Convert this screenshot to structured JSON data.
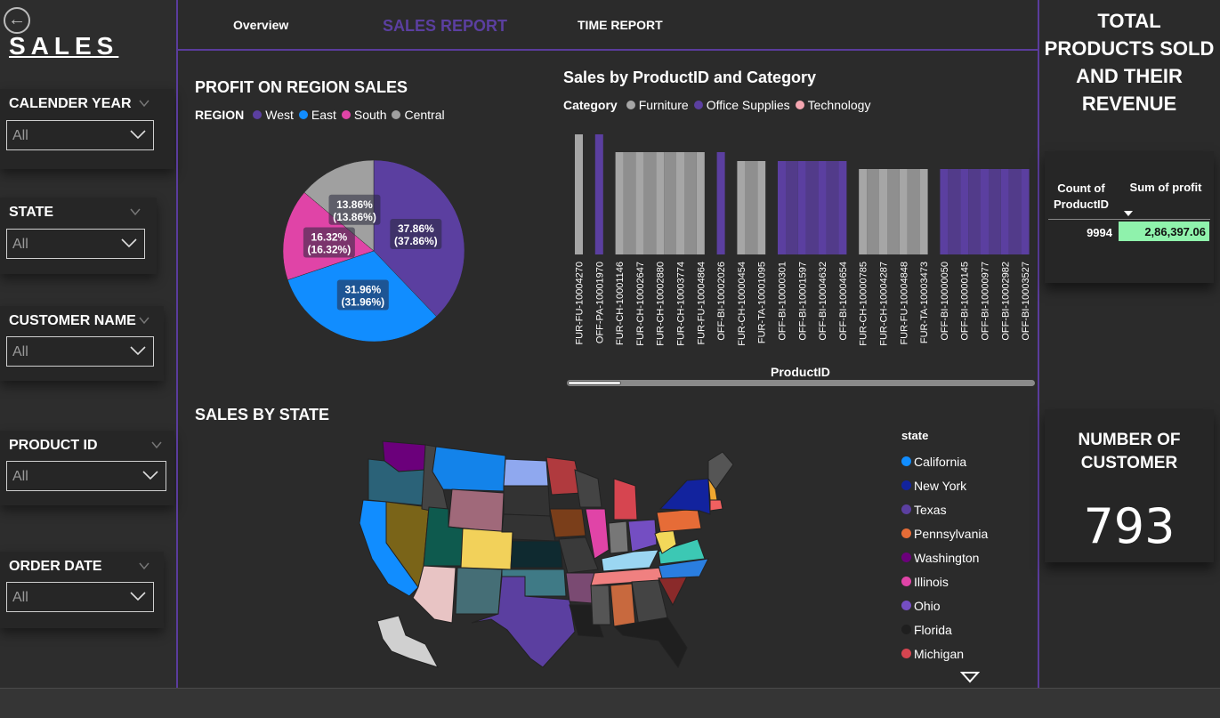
{
  "brand": {
    "title": "SALES"
  },
  "slicers": [
    {
      "title": "CALENDER YEAR",
      "value": "All"
    },
    {
      "title": "STATE",
      "value": "All"
    },
    {
      "title": "CUSTOMER NAME",
      "value": "All"
    },
    {
      "title": "PRODUCT ID",
      "value": "All"
    },
    {
      "title": "ORDER DATE",
      "value": "All"
    }
  ],
  "nav": {
    "overview": "Overview",
    "sales_report": "SALES REPORT",
    "time_report": "TIME REPORT"
  },
  "pie": {
    "title": "PROFIT ON REGION SALES",
    "legend_title": "REGION",
    "regions": [
      {
        "name": "West",
        "value": 37.86,
        "label": "37.86%",
        "sub": "(37.86%)",
        "color": "#5b3fa0"
      },
      {
        "name": "East",
        "value": 31.96,
        "label": "31.96%",
        "sub": "(31.96%)",
        "color": "#118dff"
      },
      {
        "name": "South",
        "value": 16.32,
        "label": "16.32%",
        "sub": "(16.32%)",
        "color": "#e044a7"
      },
      {
        "name": "Central",
        "value": 13.86,
        "label": "13.86%",
        "sub": "(13.86%)",
        "color": "#a0a0a0"
      }
    ]
  },
  "bars": {
    "title": "Sales by ProductID and Category",
    "legend_title": "Category",
    "xlabel": "ProductID",
    "categories": [
      {
        "name": "Furniture",
        "color": "#a6a6a6"
      },
      {
        "name": "Office Supplies",
        "color": "#5b3fa0"
      },
      {
        "name": "Technology",
        "color": "#f4a6b0"
      }
    ]
  },
  "chart_data": {
    "type": "bar",
    "categories": [
      "FUR-FU-10004270",
      "OFF-PA-10001970",
      "FUR-CH-10001146",
      "FUR-CH-10002647",
      "FUR-CH-10002880",
      "FUR-CH-10003774",
      "FUR-FU-10004864",
      "OFF-BI-10002026",
      "FUR-CH-10000454",
      "FUR-TA-10001095",
      "OFF-BI-10000301",
      "OFF-BI-10001597",
      "OFF-BI-10004632",
      "OFF-BI-10004654",
      "FUR-CH-10000785",
      "FUR-CH-10004287",
      "FUR-FU-10004848",
      "FUR-TA-10003473",
      "OFF-BI-10000050",
      "OFF-BI-10000145",
      "OFF-BI-10000977",
      "OFF-BI-10002982",
      "OFF-BI-10003527"
    ],
    "series_category": [
      "Furniture",
      "Office Supplies",
      "Furniture",
      "Furniture",
      "Furniture",
      "Furniture",
      "Furniture",
      "Office Supplies",
      "Furniture",
      "Furniture",
      "Office Supplies",
      "Office Supplies",
      "Office Supplies",
      "Office Supplies",
      "Furniture",
      "Furniture",
      "Furniture",
      "Furniture",
      "Office Supplies",
      "Office Supplies",
      "Office Supplies",
      "Office Supplies",
      "Office Supplies"
    ],
    "values": [
      135,
      135,
      115,
      115,
      115,
      115,
      115,
      115,
      105,
      105,
      105,
      105,
      105,
      105,
      96,
      96,
      96,
      96,
      96,
      96,
      96,
      96,
      96
    ],
    "ylim": [
      0,
      135
    ]
  },
  "map": {
    "title": "SALES BY STATE",
    "legend_title": "state",
    "states": [
      {
        "name": "California",
        "color": "#118dff"
      },
      {
        "name": "New York",
        "color": "#12239e"
      },
      {
        "name": "Texas",
        "color": "#5b3fa0"
      },
      {
        "name": "Pennsylvania",
        "color": "#e66c37"
      },
      {
        "name": "Washington",
        "color": "#6b007b"
      },
      {
        "name": "Illinois",
        "color": "#e044a7"
      },
      {
        "name": "Ohio",
        "color": "#744ec2"
      },
      {
        "name": "Florida",
        "color": "#1f1f1f"
      },
      {
        "name": "Michigan",
        "color": "#d64550"
      }
    ]
  },
  "right": {
    "heading": "TOTAL PRODUCTS SOLD AND THEIR REVENUE",
    "table": {
      "col1": "Count of ProductID",
      "col2": "Sum of profit",
      "count": "9994",
      "profit": "2,86,397.06"
    },
    "customers_title": "NUMBER OF CUSTOMER",
    "customers_value": "793"
  }
}
